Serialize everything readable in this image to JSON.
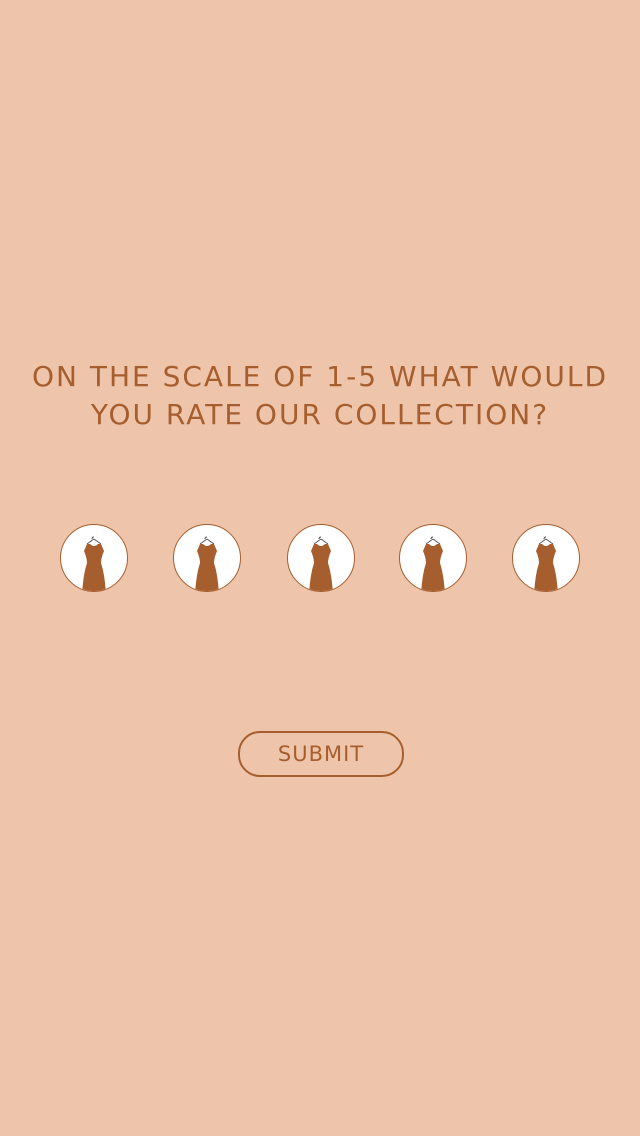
{
  "survey": {
    "question_line_1": "ON THE SCALE OF 1-5 WHAT WOULD",
    "question_line_2": "YOU RATE OUR COLLECTION?",
    "options": [
      {
        "value": 1,
        "icon": "dress-icon"
      },
      {
        "value": 2,
        "icon": "dress-icon"
      },
      {
        "value": 3,
        "icon": "dress-icon"
      },
      {
        "value": 4,
        "icon": "dress-icon"
      },
      {
        "value": 5,
        "icon": "dress-icon"
      }
    ],
    "submit_label": "SUBMIT"
  },
  "colors": {
    "background": "#EEC5AA",
    "accent": "#A65E2E",
    "circle_fill": "#FFFFFF"
  }
}
